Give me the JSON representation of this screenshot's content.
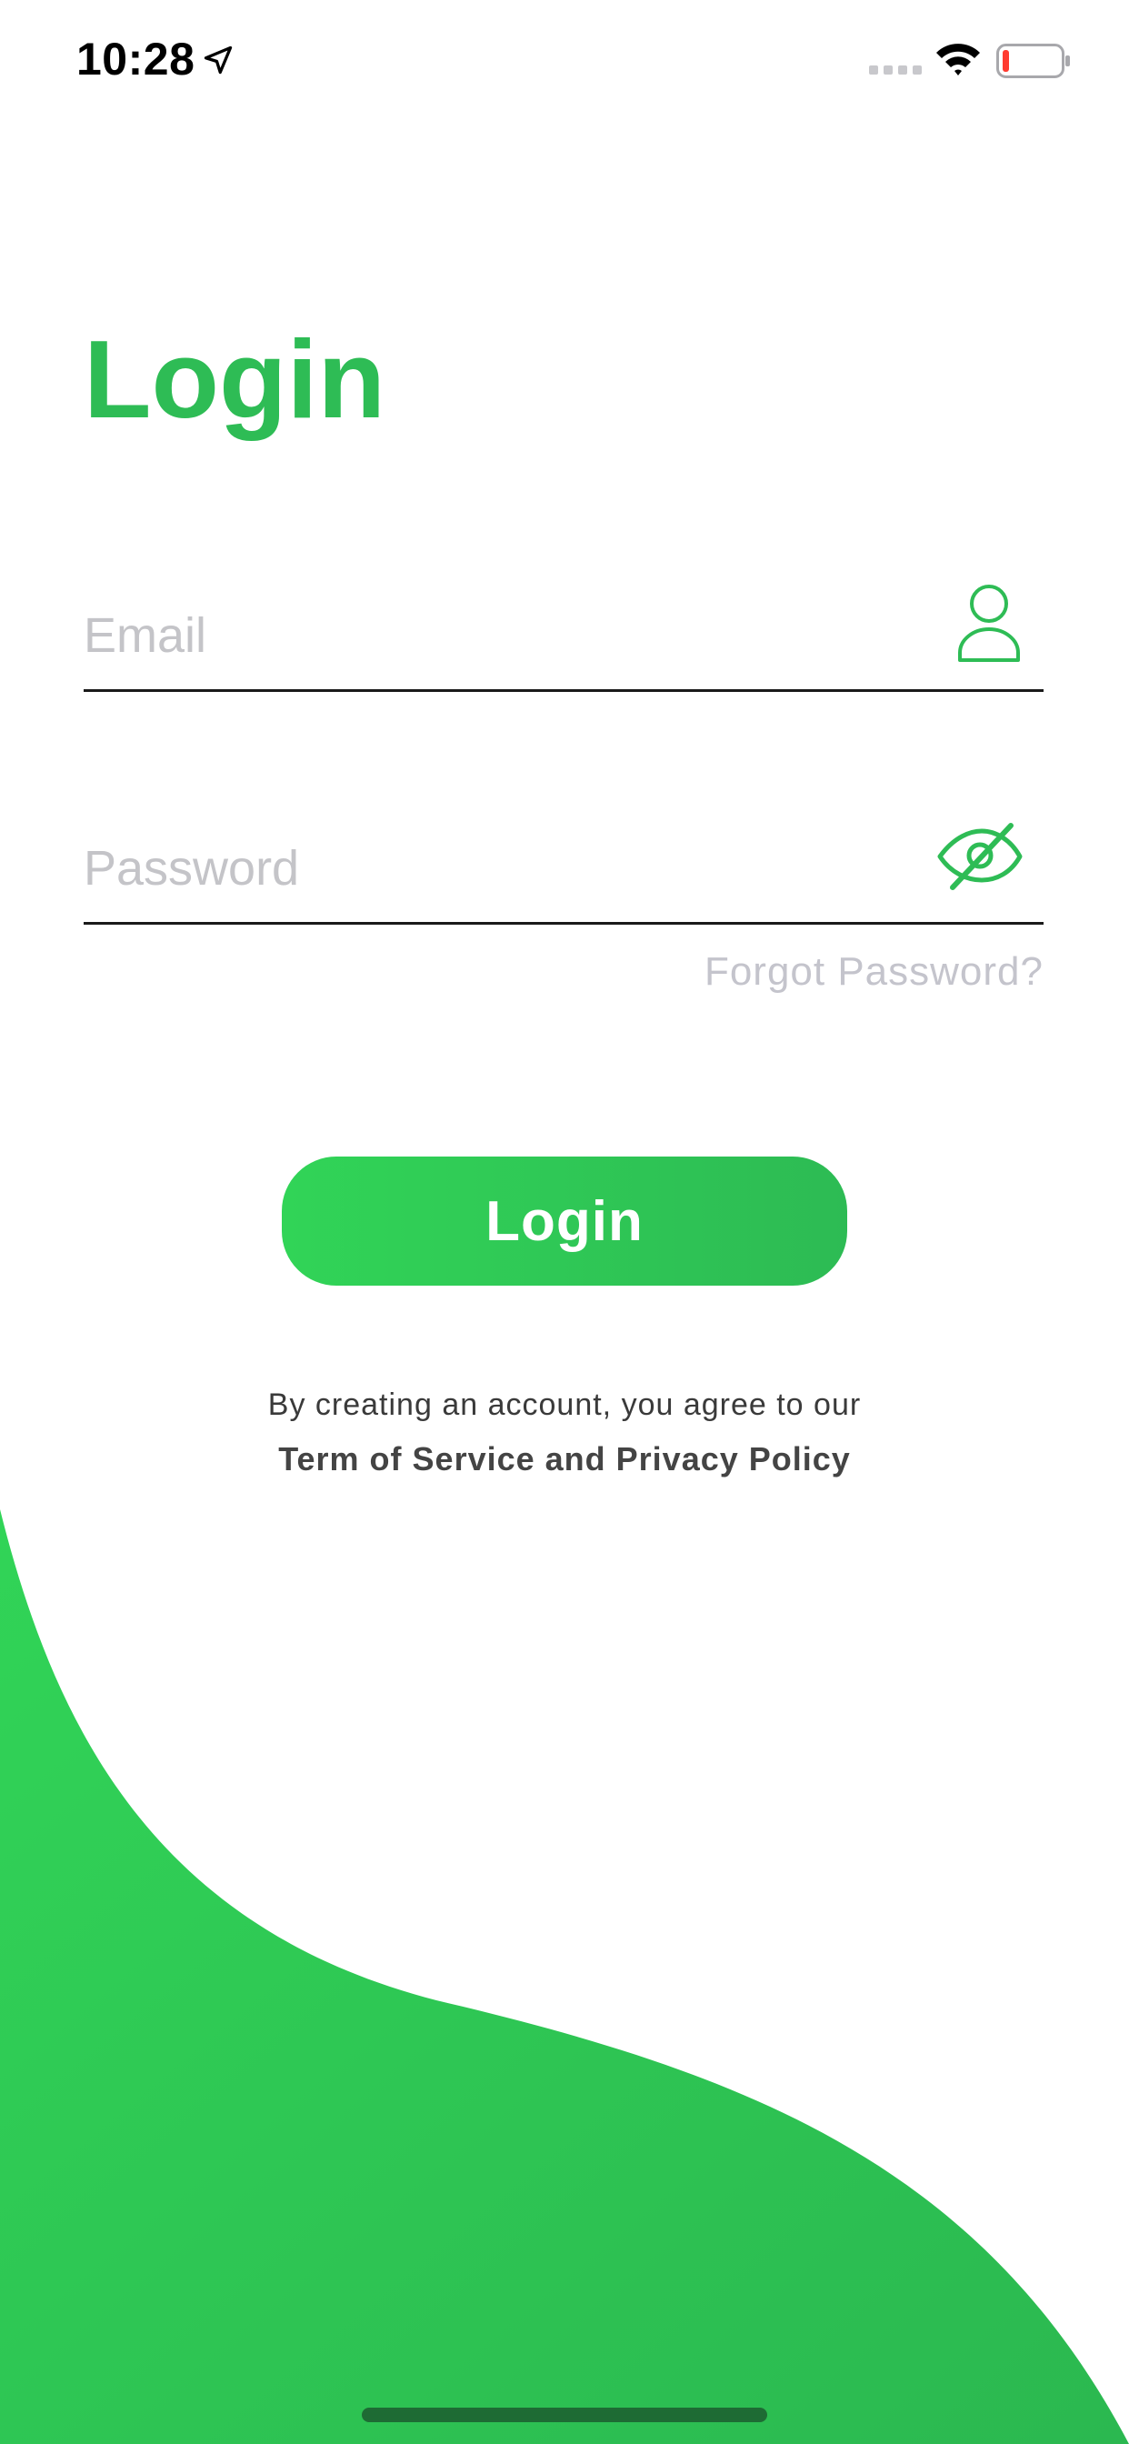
{
  "status_bar": {
    "time": "10:28"
  },
  "login": {
    "title": "Login",
    "email_placeholder": "Email",
    "email_value": "",
    "password_placeholder": "Password",
    "password_value": "",
    "forgot_password": "Forgot Password?",
    "button_label": "Login"
  },
  "terms": {
    "prefix": "By creating an account, you agree to our",
    "link": "Term of Service and Privacy Policy"
  },
  "icons": {
    "location": "location-arrow-icon",
    "signal": "cellular-signal-icon",
    "wifi": "wifi-icon",
    "battery": "battery-low-icon",
    "email_field": "user-icon",
    "password_field": "eye-slash-icon"
  },
  "colors": {
    "brand_green": "#2ebc55",
    "gradient_light": "#31d457",
    "gradient_dark": "#2dbb54",
    "placeholder": "#c4c4c8",
    "battery_low": "#ff3b30"
  }
}
